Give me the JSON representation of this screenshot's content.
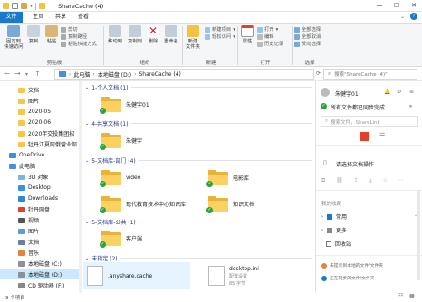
{
  "window": {
    "title": "ShareCache (4)",
    "minimize": "—",
    "maximize": "☐",
    "close": "✕"
  },
  "ribbon_tabs": [
    "文件",
    "主页",
    "共享",
    "查看"
  ],
  "ribbon": {
    "clipboard": {
      "pin_quick": "固定到\n快速访问",
      "copy": "复制",
      "paste": "粘贴",
      "cut": "剪切",
      "copy_path": "复制路径",
      "paste_shortcut": "粘贴快捷方式",
      "label": "剪贴板"
    },
    "organize": {
      "move_to": "移动到",
      "copy_to": "复制到",
      "delete": "删除",
      "rename": "重命名",
      "label": "组织"
    },
    "new": {
      "new_folder": "新建\n文件夹",
      "new_item": "新建项目",
      "easy_access": "轻松访问",
      "label": "新建"
    },
    "open": {
      "properties": "属性",
      "open": "打开",
      "edit": "编辑",
      "history": "历史记录",
      "label": "打开"
    },
    "select": {
      "select_all": "全部选择",
      "select_none": "全部取消",
      "invert": "反向选择",
      "label": "选择"
    }
  },
  "address": {
    "crumbs": [
      "此电脑",
      "本地磁盘 (D:)",
      "ShareCache (4)"
    ],
    "search_placeholder": "搜索\"ShareCache (4)\""
  },
  "navpane": [
    {
      "label": "文档",
      "icon": "folder-icon"
    },
    {
      "label": "图片",
      "icon": "folder-icon"
    },
    {
      "label": "2020-05",
      "icon": "folder-icon"
    },
    {
      "label": "2020-06",
      "icon": "folder-icon"
    },
    {
      "label": "2020年交投集团招",
      "icon": "folder-icon"
    },
    {
      "label": "牡丹江夏阿俄营业部",
      "icon": "folder-icon"
    },
    {
      "label": "OneDrive",
      "icon": "cloud-icon"
    },
    {
      "label": "此电脑",
      "icon": "computer-icon"
    },
    {
      "label": "3D 对象",
      "icon": "3d-objects-icon"
    },
    {
      "label": "Desktop",
      "icon": "desktop-icon"
    },
    {
      "label": "Downloads",
      "icon": "downloads-icon"
    },
    {
      "label": "牡丹网盘",
      "icon": "drive-icon"
    },
    {
      "label": "视频",
      "icon": "video-icon"
    },
    {
      "label": "图片",
      "icon": "pictures-icon"
    },
    {
      "label": "文档",
      "icon": "documents-icon"
    },
    {
      "label": "音乐",
      "icon": "music-icon"
    },
    {
      "label": "本地磁盘 (C:)",
      "icon": "disk-icon"
    },
    {
      "label": "本地磁盘 (D:)",
      "icon": "disk-icon"
    },
    {
      "label": "CD 驱动器 (F:)",
      "icon": "cd-icon"
    }
  ],
  "groups": [
    {
      "header": "1-个人文档 (1)",
      "items": [
        "朱健宇01"
      ]
    },
    {
      "header": "4-共享文档 (1)",
      "items": [
        "朱健宇"
      ]
    },
    {
      "header": "5-文档库-部门 (4)",
      "items": [
        "video",
        "电影库",
        "现代教育技术中心知识库",
        "知识文档"
      ]
    },
    {
      "header": "5-文档库-公共 (1)",
      "items": [
        "客户端"
      ]
    },
    {
      "header": "未指定 (2)",
      "items": [
        ".anyshare.cache",
        "desktop.ini"
      ]
    }
  ],
  "desktop_ini_meta": {
    "type": "配置设置",
    "size": "85 字节"
  },
  "right_panel": {
    "user": "朱健宇01",
    "sync_status": "所有文件都已同步完成",
    "search_placeholder": "搜索文件，ShareLink",
    "menu_more": "请选择文档操作",
    "recent_label": "我的收藏",
    "common": "常用",
    "more": "更多",
    "recycle": "回收站",
    "note1": "未提示到本地的文件/文件夹",
    "note2": "正在同步的文件/文件夹"
  },
  "status": {
    "count": "9 个项目"
  },
  "colors": {
    "accent": "#1979ca",
    "folder": "#fbd262",
    "sync_green": "#27a43a",
    "red": "#e0412b"
  }
}
